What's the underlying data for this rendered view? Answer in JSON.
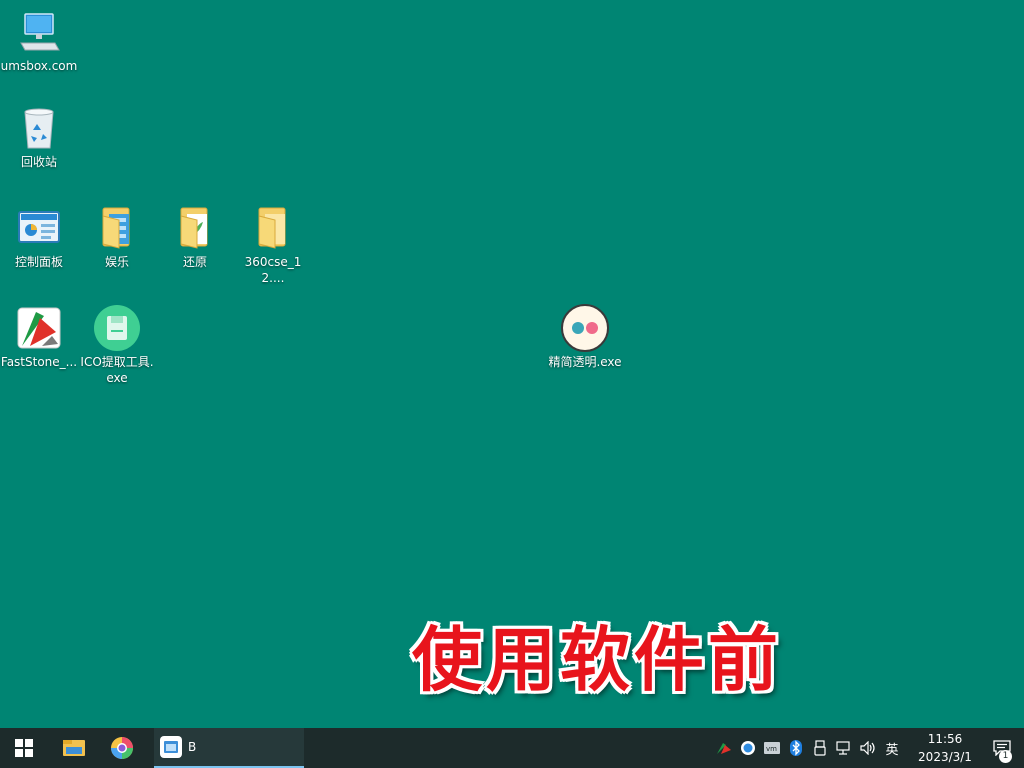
{
  "desktop_icons": [
    {
      "label": "umsbox.com",
      "icon": "computer-icon"
    },
    {
      "label": "回收站",
      "icon": "recycle-bin-icon"
    },
    {
      "label": "控制面板",
      "icon": "control-panel-icon"
    },
    {
      "label": "娱乐",
      "icon": "folder-icon"
    },
    {
      "label": "还原",
      "icon": "folder-icon"
    },
    {
      "label": "360cse_12....",
      "icon": "folder-icon"
    },
    {
      "label": "FastStone_...",
      "icon": "faststone-icon"
    },
    {
      "label": "ICO提取工具.exe",
      "icon": "floppy-app-icon"
    },
    {
      "label": "精简透明.exe",
      "icon": "eyes-app-icon"
    }
  ],
  "overlay_caption": "使用软件前",
  "taskbar": {
    "running_app_label": "B",
    "tray_language": "英",
    "clock_time": "11:56",
    "clock_date": "2023/3/1",
    "notification_count": "1"
  },
  "colors": {
    "desktop_bg": "#008573",
    "taskbar_bg": "#1d2b2b",
    "caption_red": "#e8141c"
  }
}
